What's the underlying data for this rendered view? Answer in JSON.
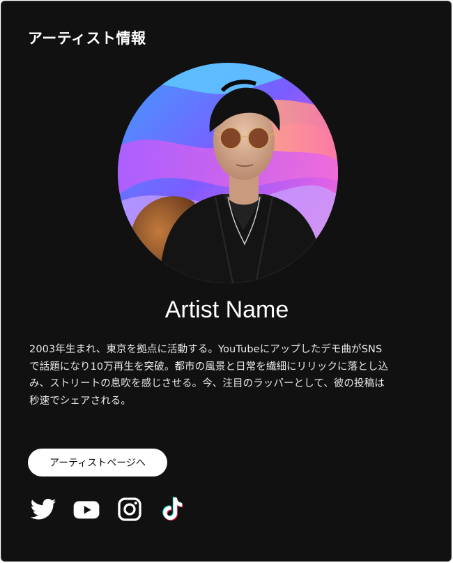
{
  "section": {
    "title": "アーティスト情報"
  },
  "artist": {
    "name": "Artist Name",
    "bio_lines": [
      "2003年生まれ、東京を拠点に活動する。YouTubeにアップしたデモ曲がSNS",
      "で話題になり10万再生を突破。都市の風景と日常を繊細にリリックに落とし込",
      "み、ストリートの息吹を感じさせる。今、注目のラッパーとして、彼の投稿は",
      "秒速でシェアされる。"
    ]
  },
  "actions": {
    "artist_page_label": "アーティストページへ"
  },
  "socials": [
    {
      "icon": "twitter-icon"
    },
    {
      "icon": "youtube-icon"
    },
    {
      "icon": "instagram-icon"
    },
    {
      "icon": "tiktok-icon"
    }
  ],
  "colors": {
    "background": "#111111",
    "text": "#ffffff",
    "button_bg": "#ffffff",
    "button_text": "#111111",
    "tiktok_cyan": "#25f4ee",
    "tiktok_red": "#fe2c55"
  }
}
